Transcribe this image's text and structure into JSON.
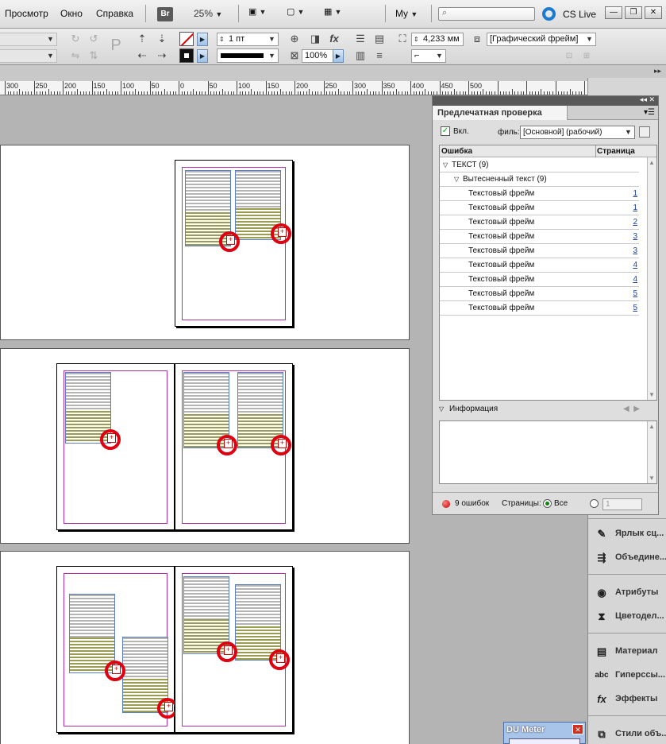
{
  "menu": [
    "Просмотр",
    "Окно",
    "Справка"
  ],
  "appbar": {
    "bridge_badge": "Br",
    "zoom": "25%",
    "workspace": "My",
    "cs_live": "CS Live"
  },
  "window_buttons": [
    "—",
    "❐",
    "✕"
  ],
  "control": {
    "stroke_weight": "1 пт",
    "dimension": "4,233 мм",
    "scale": "100%",
    "object_style": "[Графический фрейм]"
  },
  "ruler_labels": [
    "300",
    "250",
    "200",
    "150",
    "100",
    "50",
    "0",
    "50",
    "100",
    "150",
    "200",
    "250",
    "300",
    "350",
    "400",
    "450",
    "500"
  ],
  "preflight": {
    "title": "Предлечатная проверка",
    "on_label": "Вкл.",
    "profile_label": "филь:",
    "profile_value": "[Основной] (рабочий)",
    "col_error": "Ошибка",
    "col_page": "Страница",
    "group": "ТЕКСТ (9)",
    "subgroup": "Вытесненный текст (9)",
    "items": [
      {
        "name": "Текстовый фрейм",
        "page": "1"
      },
      {
        "name": "Текстовый фрейм",
        "page": "1"
      },
      {
        "name": "Текстовый фрейм",
        "page": "2"
      },
      {
        "name": "Текстовый фрейм",
        "page": "3"
      },
      {
        "name": "Текстовый фрейм",
        "page": "3"
      },
      {
        "name": "Текстовый фрейм",
        "page": "4"
      },
      {
        "name": "Текстовый фрейм",
        "page": "4"
      },
      {
        "name": "Текстовый фрейм",
        "page": "5"
      },
      {
        "name": "Текстовый фрейм",
        "page": "5"
      }
    ],
    "info_label": "Информация",
    "error_count": "9 ошибок",
    "pages_label": "Страницы:",
    "all_label": "Все",
    "range_value": "1"
  },
  "dock": {
    "items": [
      {
        "icon": "label-icon",
        "label": "Ярлык сц..."
      },
      {
        "icon": "merge-icon",
        "label": "Объедине..."
      },
      {
        "icon": "attributes-icon",
        "label": "Атрибуты"
      },
      {
        "icon": "separations-icon",
        "label": "Цветодел..."
      },
      {
        "icon": "material-icon",
        "label": "Материал"
      },
      {
        "icon": "hyphenation-icon",
        "label": "Гиперссы..."
      },
      {
        "icon": "effects-icon",
        "label": "Эффекты"
      },
      {
        "icon": "object-styles-icon",
        "label": "Стили объ..."
      }
    ]
  },
  "du_meter": {
    "title": "DU Meter"
  },
  "colors": {
    "overset_marker": "#e00010",
    "margin_guide": "#b030b0",
    "frame_edge": "#5a7ec8"
  }
}
